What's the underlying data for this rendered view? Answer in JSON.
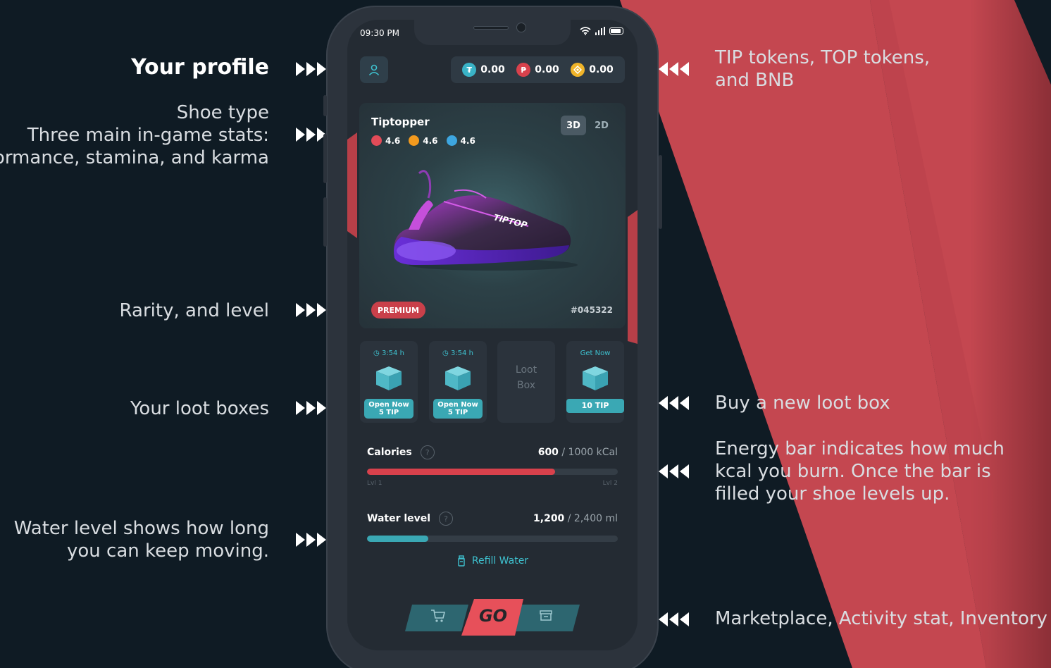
{
  "annotations": {
    "profile": "Your profile",
    "shoe_line1": "Shoe type",
    "shoe_line2": "Three main in-game stats:",
    "shoe_line3": "performance, stamina, and karma",
    "rarity": "Rarity, and level",
    "loot": "Your loot boxes",
    "water_line1": "Water level shows how long",
    "water_line2": "you can keep moving.",
    "tokens_line1": "TIP tokens, TOP tokens,",
    "tokens_line2": "and BNB",
    "buy": "Buy a new loot box",
    "energy_line1": "Energy bar indicates how much",
    "energy_line2": "kcal you burn. Once the bar is",
    "energy_line3": "filled your shoe levels up.",
    "nav": "Marketplace, Activity stat, Inventory"
  },
  "status": {
    "time": "09:30 PM"
  },
  "header": {
    "profile_icon": "user-icon",
    "tokens": [
      {
        "value": "0.00",
        "color": "#3ab3c7"
      },
      {
        "value": "0.00",
        "color": "#d8414c"
      },
      {
        "value": "0.00",
        "color": "#f0b429"
      }
    ]
  },
  "shoe": {
    "name": "Tiptopper",
    "stats": [
      {
        "value": "4.6",
        "color": "#e24b58"
      },
      {
        "value": "4.6",
        "color": "#f39a1e"
      },
      {
        "value": "4.6",
        "color": "#3da6e0"
      }
    ],
    "view_3d": "3D",
    "view_2d": "2D",
    "brand": "TIPTOP",
    "rarity": "PREMIUM",
    "serial": "#045322"
  },
  "loot_boxes": [
    {
      "timer": "3:54 h",
      "open_line1": "Open Now",
      "open_line2": "5 TIP"
    },
    {
      "timer": "3:54 h",
      "open_line1": "Open Now",
      "open_line2": "5 TIP"
    },
    {
      "empty_line1": "Loot",
      "empty_line2": "Box"
    },
    {
      "get": "Get Now",
      "price": "10 TIP"
    }
  ],
  "calories": {
    "label": "Calories",
    "help": "?",
    "current": "600",
    "max": "/ 1000 kCal",
    "progress": 0.75,
    "level_from": "Lvl 1",
    "level_to": "Lvl 2",
    "color": "#d8414c"
  },
  "water": {
    "label": "Water level",
    "help": "?",
    "current": "1,200",
    "max": "/ 2,400 ml",
    "progress": 0.245,
    "color": "#3aa8b4",
    "refill": "Refill Water"
  },
  "nav": {
    "go": "GO",
    "marketplace_icon": "cart-icon",
    "inventory_icon": "archive-icon"
  }
}
